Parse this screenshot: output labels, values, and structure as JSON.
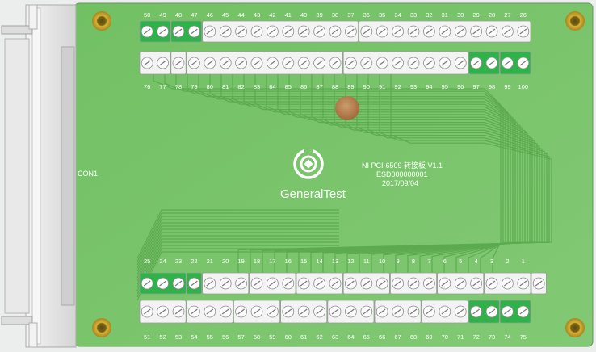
{
  "connector": {
    "label": "CON1"
  },
  "logo": {
    "text": "GeneralTest"
  },
  "board_info": {
    "line1": "NI PCI-6509 转接板 V1.1",
    "line2": "ESD000000001",
    "line3": "2017/09/04"
  },
  "colors": {
    "pcb_green": "#78c46a",
    "terminal_green": "#2fb24a",
    "terminal_white": "#f3f3f3",
    "mounting_hole": "#c9a227",
    "center_pad": "#c2784a",
    "trace": "#5aa84e",
    "connector_gray": "#dcdcdc"
  },
  "top_row_back": {
    "labels": [
      "50",
      "49",
      "48",
      "47",
      "46",
      "45",
      "44",
      "43",
      "42",
      "41",
      "40",
      "39",
      "38",
      "37",
      "36",
      "35",
      "34",
      "33",
      "32",
      "31",
      "30",
      "29",
      "28",
      "27",
      "26"
    ],
    "blocks": [
      [
        "green",
        2
      ],
      [
        "green",
        2
      ],
      [
        "white",
        10
      ],
      [
        "white",
        11
      ]
    ]
  },
  "top_row_front": {
    "labels": [
      "76",
      "77",
      "78",
      "79",
      "80",
      "81",
      "82",
      "83",
      "84",
      "85",
      "86",
      "87",
      "88",
      "89",
      "90",
      "91",
      "92",
      "93",
      "94",
      "95",
      "96",
      "97",
      "98",
      "99",
      "100"
    ],
    "blocks": [
      [
        "white",
        2
      ],
      [
        "white",
        1
      ],
      [
        "white",
        10
      ],
      [
        "white",
        8
      ],
      [
        "green",
        2
      ],
      [
        "green",
        2
      ]
    ]
  },
  "bottom_row_back": {
    "labels": [
      "25",
      "24",
      "23",
      "22",
      "21",
      "20",
      "19",
      "18",
      "17",
      "16",
      "15",
      "14",
      "13",
      "12",
      "11",
      "10",
      "9",
      "8",
      "7",
      "6",
      "5",
      "4",
      "3",
      "2",
      "1"
    ],
    "blocks": [
      [
        "green",
        3
      ],
      [
        "green",
        1
      ],
      [
        "white",
        3
      ],
      [
        "white",
        3
      ],
      [
        "white",
        3
      ],
      [
        "white",
        3
      ],
      [
        "white",
        3
      ],
      [
        "white",
        3
      ],
      [
        "white",
        3
      ],
      [
        "white",
        1
      ]
    ]
  },
  "bottom_row_front": {
    "labels": [
      "51",
      "52",
      "53",
      "54",
      "55",
      "56",
      "57",
      "58",
      "59",
      "60",
      "61",
      "62",
      "63",
      "64",
      "65",
      "66",
      "67",
      "68",
      "69",
      "70",
      "71",
      "72",
      "73",
      "74",
      "75"
    ],
    "blocks": [
      [
        "white",
        3
      ],
      [
        "white",
        3
      ],
      [
        "white",
        3
      ],
      [
        "white",
        3
      ],
      [
        "white",
        3
      ],
      [
        "white",
        3
      ],
      [
        "white",
        3
      ],
      [
        "green",
        2
      ],
      [
        "green",
        2
      ]
    ]
  }
}
